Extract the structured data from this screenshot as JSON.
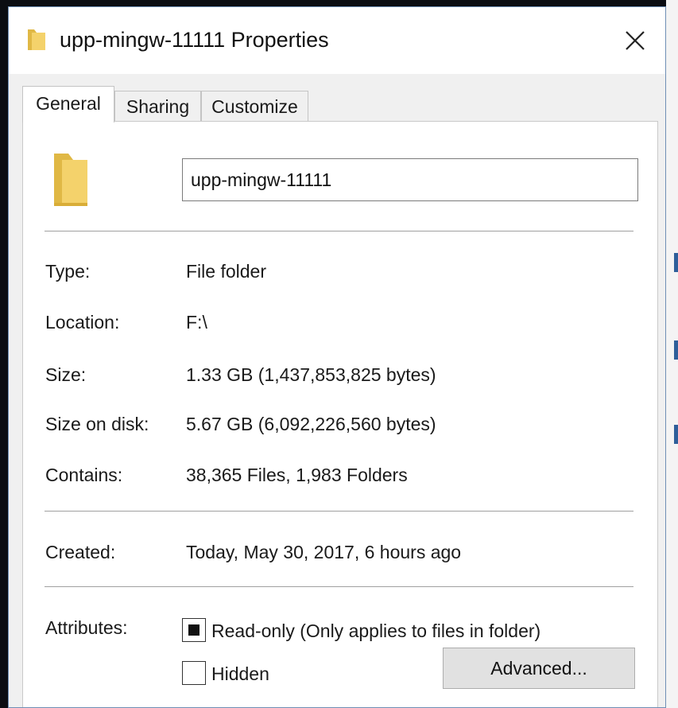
{
  "window": {
    "title": "upp-mingw-11111 Properties",
    "title_icon": "folder-icon",
    "close_icon": "close-icon"
  },
  "tabs": [
    {
      "label": "General",
      "active": true
    },
    {
      "label": "Sharing",
      "active": false
    },
    {
      "label": "Customize",
      "active": false
    }
  ],
  "general": {
    "folder_icon": "folder-icon",
    "name_value": "upp-mingw-11111",
    "type_label": "Type:",
    "type_value": "File folder",
    "location_label": "Location:",
    "location_value": "F:\\",
    "size_label": "Size:",
    "size_value": "1.33 GB (1,437,853,825 bytes)",
    "size_on_disk_label": "Size on disk:",
    "size_on_disk_value": "5.67 GB (6,092,226,560 bytes)",
    "contains_label": "Contains:",
    "contains_value": "38,365 Files, 1,983 Folders",
    "created_label": "Created:",
    "created_value": "Today, May 30, 2017, 6 hours ago",
    "attributes_label": "Attributes:",
    "readonly_label": "Read-only (Only applies to files in folder)",
    "readonly_state": "indeterminate",
    "hidden_label": "Hidden",
    "hidden_state": "unchecked",
    "advanced_button": "Advanced..."
  },
  "colors": {
    "folder_yellow": "#f4d26b",
    "folder_shade": "#e0b845",
    "dialog_border": "#6f8fb5"
  }
}
